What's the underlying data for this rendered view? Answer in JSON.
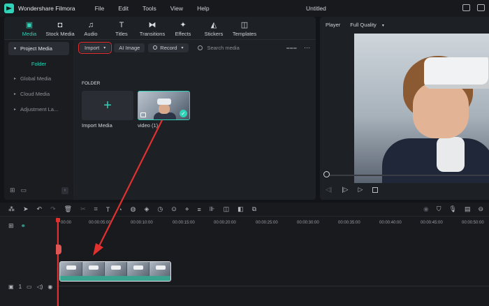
{
  "titlebar": {
    "app_name": "Wondershare Filmora",
    "menu": [
      "File",
      "Edit",
      "Tools",
      "View",
      "Help"
    ],
    "document_title": "Untitled"
  },
  "tabs": [
    {
      "label": "Media",
      "icon": "media-icon",
      "active": true
    },
    {
      "label": "Stock Media",
      "icon": "stock-media-icon",
      "active": false
    },
    {
      "label": "Audio",
      "icon": "music-note-icon",
      "active": false
    },
    {
      "label": "Titles",
      "icon": "titles-icon",
      "active": false
    },
    {
      "label": "Transitions",
      "icon": "transitions-icon",
      "active": false
    },
    {
      "label": "Effects",
      "icon": "effects-icon",
      "active": false
    },
    {
      "label": "Stickers",
      "icon": "stickers-icon",
      "active": false
    },
    {
      "label": "Templates",
      "icon": "templates-icon",
      "active": false
    }
  ],
  "sidebar": {
    "project_media": "Project Media",
    "folder": "Folder",
    "items": [
      "Global Media",
      "Cloud Media",
      "Adjustment La..."
    ]
  },
  "toolbar": {
    "import": "Import",
    "ai_image": "AI Image",
    "record": "Record",
    "search_placeholder": "Search media"
  },
  "library": {
    "folder_label": "FOLDER",
    "import_caption": "Import Media",
    "video_caption": "video (1)"
  },
  "player": {
    "label": "Player",
    "quality": "Full Quality"
  },
  "timeline": {
    "ruler": [
      "00:00",
      "00:00:05:00",
      "00:00:10:00",
      "00:00:15:00",
      "00:00:20:00",
      "00:00:25:00",
      "00:00:30:00",
      "00:00:35:00",
      "00:00:40:00",
      "00:00:45:00",
      "00:00:50:00"
    ],
    "video_track_number": "1",
    "audio_track_number": "1"
  },
  "colors": {
    "accent": "#2fd3b7",
    "highlight": "#e2302f",
    "panel": "#1d2024",
    "background": "#121417"
  }
}
